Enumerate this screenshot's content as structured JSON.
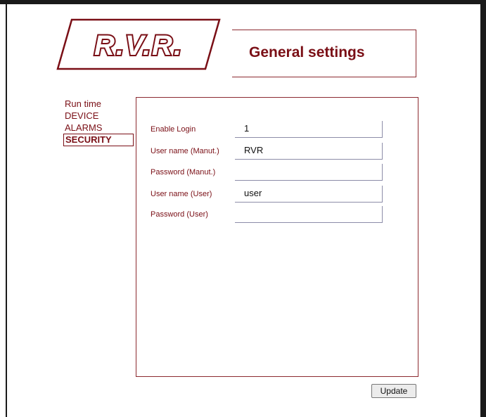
{
  "header": {
    "logo_text": "R.V.R.",
    "title": "General settings"
  },
  "menu": {
    "items": [
      {
        "label": "Run time"
      },
      {
        "label": "DEVICE"
      },
      {
        "label": "ALARMS"
      },
      {
        "label": "SECURITY",
        "active": true
      }
    ]
  },
  "form": {
    "fields": [
      {
        "label": "Enable Login",
        "value": "1"
      },
      {
        "label": "User name (Manut.)",
        "value": "RVR"
      },
      {
        "label": "Password (Manut.)",
        "value": ""
      },
      {
        "label": "User name (User)",
        "value": "user"
      },
      {
        "label": "Password (User)",
        "value": ""
      }
    ]
  },
  "actions": {
    "update_label": "Update"
  },
  "colors": {
    "brand": "#7a0f16",
    "border": "#8c2a30"
  }
}
